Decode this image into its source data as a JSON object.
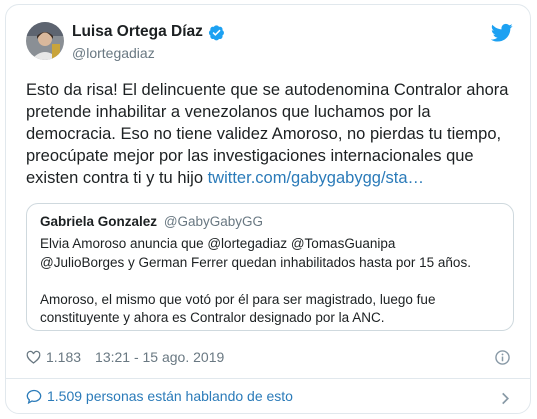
{
  "author": {
    "display_name": "Luisa Ortega Díaz",
    "handle": "@lortegadiaz"
  },
  "tweet": {
    "lines": [
      "Esto da risa! El delincuente que se autodenomina Contralor ahora",
      "pretende inhabilitar a venezolanos que luchamos por la",
      "democracia. Eso no tiene validez Amoroso, no pierdas tu tiempo,",
      "preocúpate mejor por las investigaciones internacionales que",
      "existen contra ti y tu hijo "
    ],
    "link": "twitter.com/gabygabygg/sta…"
  },
  "quoted": {
    "name": "Gabriela Gonzalez",
    "handle": "@GabyGabyGG",
    "para1": [
      "Elvia Amoroso anuncia que @lortegadiaz @TomasGuanipa",
      "@JulioBorges y German Ferrer quedan inhabilitados hasta por 15 años."
    ],
    "para2": [
      "Amoroso, el mismo que votó por él para ser magistrado, luego fue",
      "constituyente y ahora es Contralor designado por la ANC."
    ]
  },
  "meta": {
    "likes": "1.183",
    "timestamp": "13:21 - 15 ago. 2019"
  },
  "conversation": {
    "label": "1.509 personas están hablando de esto"
  },
  "colors": {
    "link": "#2b7bb9",
    "twitter_blue": "#1da1f2",
    "muted": "#697882",
    "border": "#e1e8ed"
  },
  "icons": [
    "verified-badge-icon",
    "twitter-bird-icon",
    "heart-icon",
    "info-icon",
    "speech-bubble-icon",
    "chevron-right-icon"
  ]
}
